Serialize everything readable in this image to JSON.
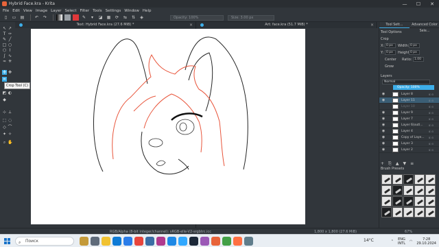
{
  "window": {
    "title": "Hybrid Face.kra - Krita",
    "minimize": "—",
    "maximize": "☐",
    "close": "✕"
  },
  "menu": [
    "File",
    "Edit",
    "View",
    "Image",
    "Layer",
    "Select",
    "Filter",
    "Tools",
    "Settings",
    "Window",
    "Help"
  ],
  "toolbar": {
    "opacity_label": "Opacity: 100%",
    "size_label": "Size: 3.00 px"
  },
  "tooltip": "Crop Tool (C)",
  "tabs": [
    {
      "label": "Text: Hybrid Face.kra (27.6 MiB) *"
    },
    {
      "label": "Art: face.kra (51.7 MiB) *"
    }
  ],
  "dock": {
    "tabs": [
      "Tool Sett...",
      "Advanced Color Sele..."
    ],
    "tool_options_title": "Tool Options",
    "crop_title": "Crop",
    "x_label": "X:",
    "x_value": "0 px",
    "y_label": "Y:",
    "y_value": "0 px",
    "width_label": "Width:",
    "width_value": "0 px",
    "height_label": "Height:",
    "height_value": "0 px",
    "center_label": "Center",
    "ratio_label": "Ratio:",
    "ratio_value": "1.00",
    "grow_label": "Grow"
  },
  "layers": {
    "title": "Layers",
    "blend_mode": "Normal",
    "opacity": "Opacity: 100%",
    "items": [
      {
        "name": "Layer 8",
        "state": "normal"
      },
      {
        "name": "Layer 11",
        "state": "selected"
      },
      {
        "name": "Layer 10",
        "state": "dim"
      },
      {
        "name": "Layer 9",
        "state": "normal"
      },
      {
        "name": "Layer 7",
        "state": "normal"
      },
      {
        "name": "Layer 6(outl...",
        "state": "normal"
      },
      {
        "name": "Layer 4",
        "state": "normal"
      },
      {
        "name": "Copy of Laye...",
        "state": "normal"
      },
      {
        "name": "Layer 3",
        "state": "normal"
      },
      {
        "name": "Layer 2",
        "state": "normal"
      }
    ],
    "buttons": [
      "+",
      "⎘",
      "▲",
      "▼",
      "≡"
    ]
  },
  "brush_presets": {
    "title": "Brush Presets"
  },
  "status": {
    "color_space": "RGB/Alpha (8-bit integer/channel): sRGB-elle-V2-srgbtrc.icc",
    "dimensions": "1,800 x 1,800 (27.6 MiB)",
    "zoom": "67%"
  },
  "taskbar": {
    "search_placeholder": "Поиск",
    "weather": "14°C",
    "lang_top": "ENG",
    "lang_bottom": "INTL",
    "time": "7:28",
    "date": "29.10.2024"
  },
  "colors": {
    "accent": "#3daee9",
    "sketch_red": "#e8543a",
    "canvas": "#ffffff"
  }
}
